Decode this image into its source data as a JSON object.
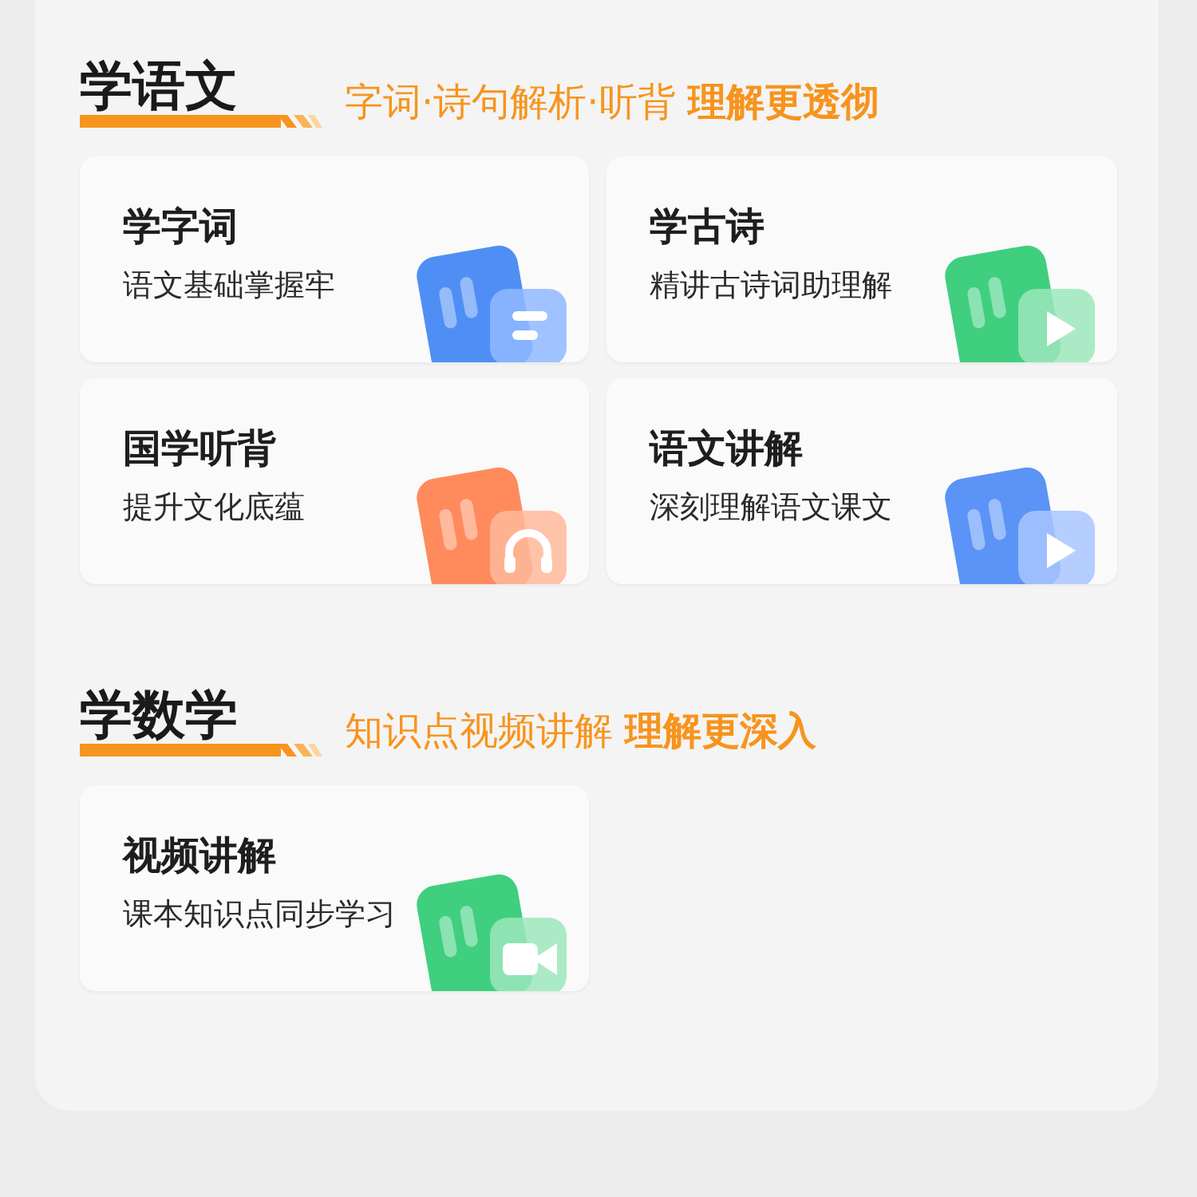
{
  "sections": [
    {
      "title": "学语文",
      "subtitle": "字词·诗句解析·听背 **理解更透彻**",
      "cards": [
        {
          "title": "学字词",
          "desc": "语文基础掌握牢",
          "kind": "words"
        },
        {
          "title": "学古诗",
          "desc": "精讲古诗词助理解",
          "kind": "poem"
        },
        {
          "title": "国学听背",
          "desc": "提升文化底蕴",
          "kind": "listen"
        },
        {
          "title": "语文讲解",
          "desc": "深刻理解语文课文",
          "kind": "lesson"
        }
      ]
    },
    {
      "title": "学数学",
      "subtitle": "知识点视频讲解 **理解更深入**",
      "cards": [
        {
          "title": "视频讲解",
          "desc": "课本知识点同步学习",
          "kind": "math"
        }
      ]
    }
  ]
}
